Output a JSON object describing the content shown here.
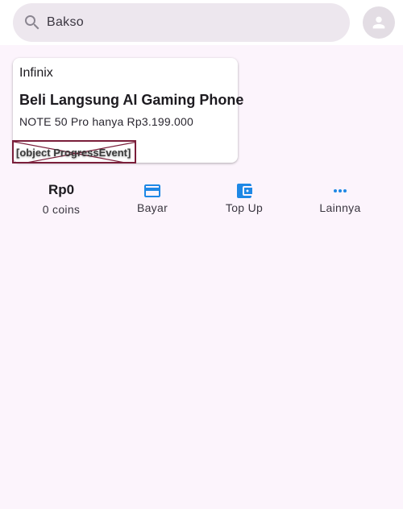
{
  "search": {
    "value": "Bakso"
  },
  "promo": {
    "brand": "Infinix",
    "title": "Beli Langsung AI Gaming Phone",
    "subtitle": "NOTE 50 Pro hanya Rp3.199.000",
    "broken_image_text": "[object ProgressEvent]"
  },
  "balance": {
    "amount": "Rp0",
    "coins": "0 coins"
  },
  "actions": [
    {
      "label": "Bayar",
      "icon": "credit-card-icon"
    },
    {
      "label": "Top Up",
      "icon": "wallet-icon"
    },
    {
      "label": "Lainnya",
      "icon": "more-horiz-icon"
    }
  ],
  "colors": {
    "accent": "#1E88E5",
    "background": "#FCF4FC",
    "search_bg": "#EDE7EE"
  }
}
